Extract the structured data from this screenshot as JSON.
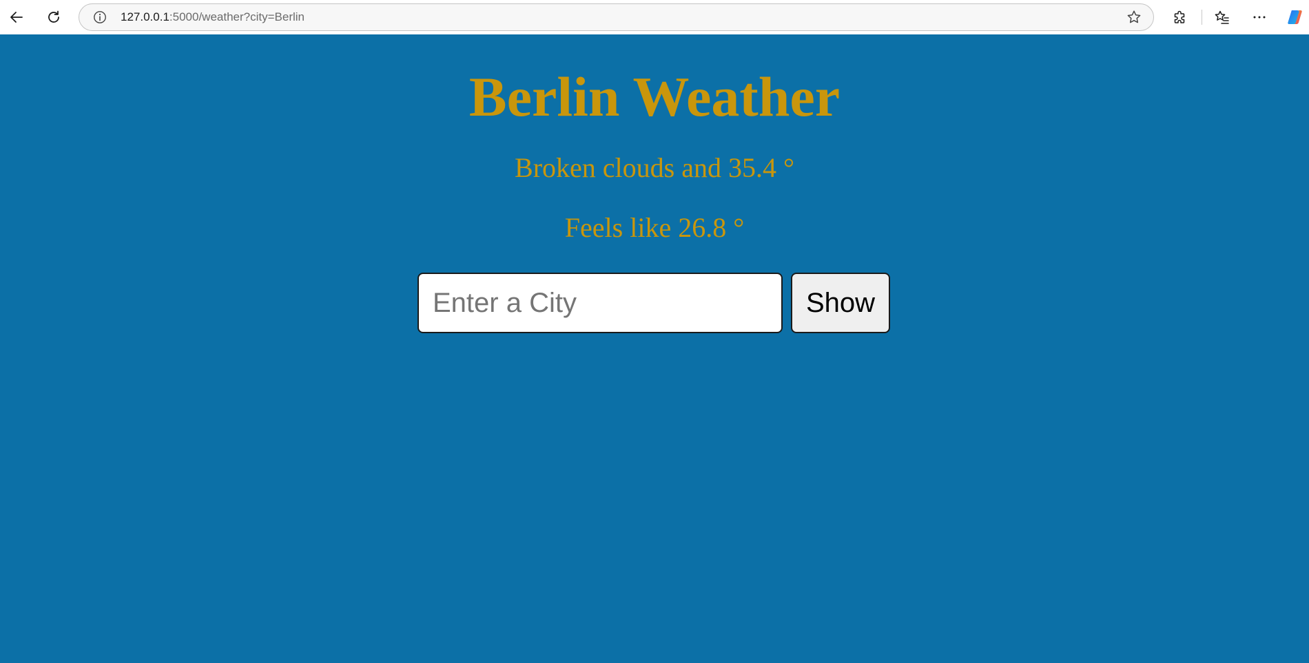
{
  "browser": {
    "url_host": "127.0.0.1",
    "url_path": ":5000/weather?city=Berlin"
  },
  "main": {
    "title": "Berlin Weather",
    "conditions": "Broken clouds and 35.4 °",
    "feels_like": "Feels like 26.8 °"
  },
  "search": {
    "placeholder": "Enter a City",
    "value": "",
    "button_label": "Show"
  },
  "colors": {
    "page_background": "#0c70a7",
    "heading_text": "#c9960c"
  },
  "icons": {
    "back": "arrow-left",
    "reload": "refresh",
    "site_info": "info-circle",
    "favorite": "star-outline",
    "extensions": "puzzle-piece",
    "favorites_list": "star-list",
    "menu": "horizontal-ellipsis",
    "copilot": "copilot-logo"
  }
}
